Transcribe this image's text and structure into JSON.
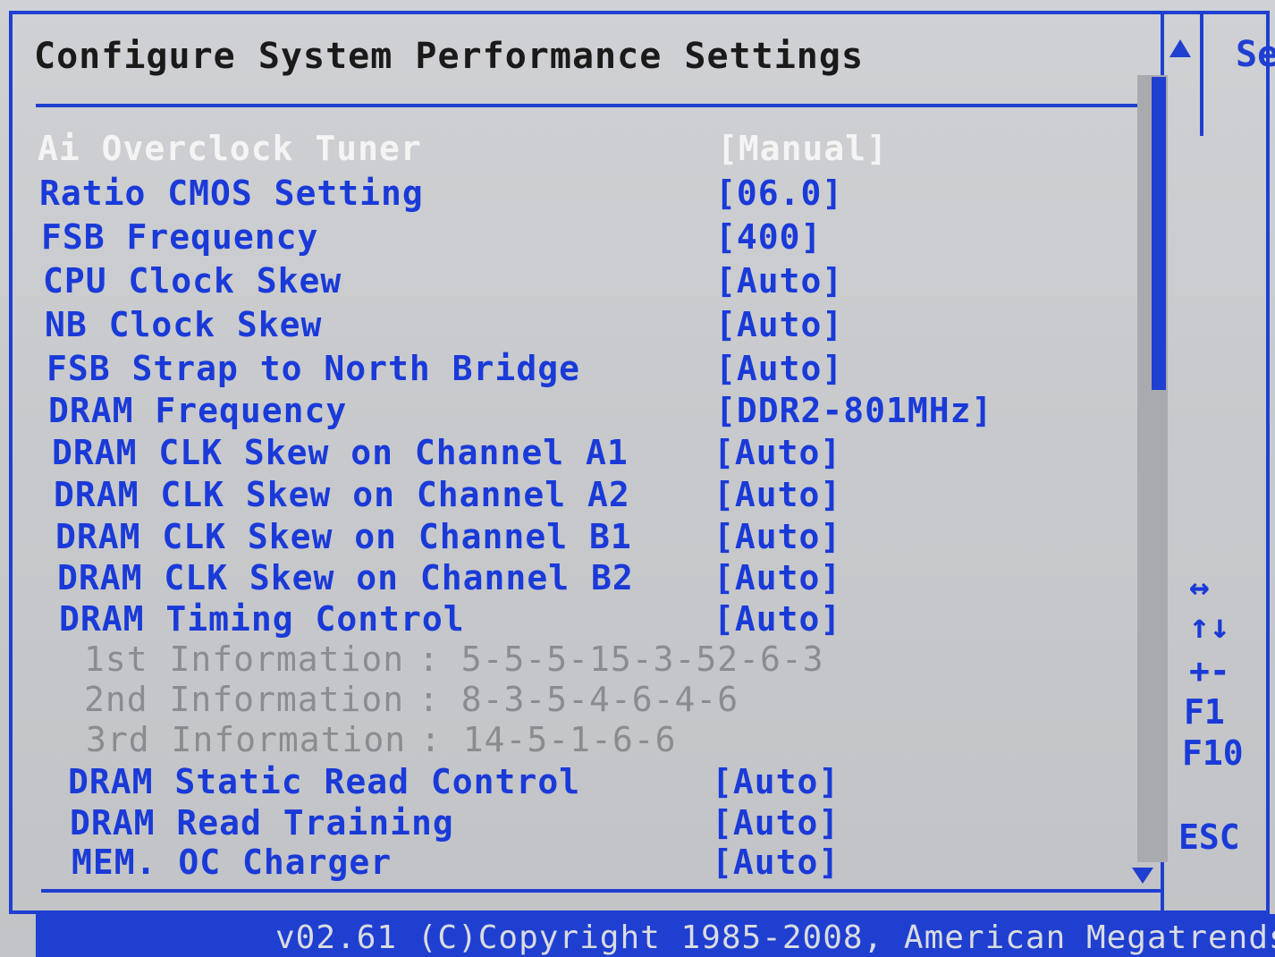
{
  "title": "Configure System Performance Settings",
  "side_title": "Se",
  "settings": [
    {
      "label": "Ai Overclock Tuner",
      "value": "[Manual]",
      "selected": true
    },
    {
      "label": "Ratio CMOS Setting",
      "value": "[06.0]"
    },
    {
      "label": "FSB Frequency",
      "value": "[400]"
    },
    {
      "label": "CPU Clock Skew",
      "value": "[Auto]"
    },
    {
      "label": "NB Clock Skew",
      "value": "[Auto]"
    },
    {
      "label": "FSB Strap to North Bridge",
      "value": "[Auto]"
    },
    {
      "label": "DRAM Frequency",
      "value": "[DDR2-801MHz]"
    },
    {
      "label": "DRAM CLK Skew on Channel A1",
      "value": "[Auto]"
    },
    {
      "label": "DRAM CLK Skew on Channel A2",
      "value": "[Auto]"
    },
    {
      "label": "DRAM CLK Skew on Channel B1",
      "value": "[Auto]"
    },
    {
      "label": "DRAM CLK Skew on Channel B2",
      "value": "[Auto]"
    },
    {
      "label": "DRAM Timing Control",
      "value": "[Auto]"
    },
    {
      "label": "1st Information",
      "value": ": 5-5-5-15-3-52-6-3",
      "info": true
    },
    {
      "label": "2nd Information",
      "value": ": 8-3-5-4-6-4-6",
      "info": true
    },
    {
      "label": "3rd Information",
      "value": ": 14-5-1-6-6",
      "info": true
    },
    {
      "label": "DRAM Static Read Control",
      "value": "[Auto]"
    },
    {
      "label": "DRAM Read Training",
      "value": "[Auto]"
    },
    {
      "label": "MEM. OC Charger",
      "value": "[Auto]"
    }
  ],
  "help_keys": {
    "left_right": "↔",
    "up_down": "↑↓",
    "plus_minus": "+-",
    "f1": "F1",
    "f10": "F10",
    "esc": "ESC"
  },
  "footer": "v02.61 (C)Copyright 1985-2008, American Megatrends",
  "colors": {
    "accent_blue": "#1f3fd0",
    "background": "#c7c9cc",
    "selected_text": "#f4f4f4",
    "info_text": "#8a8c8f"
  }
}
